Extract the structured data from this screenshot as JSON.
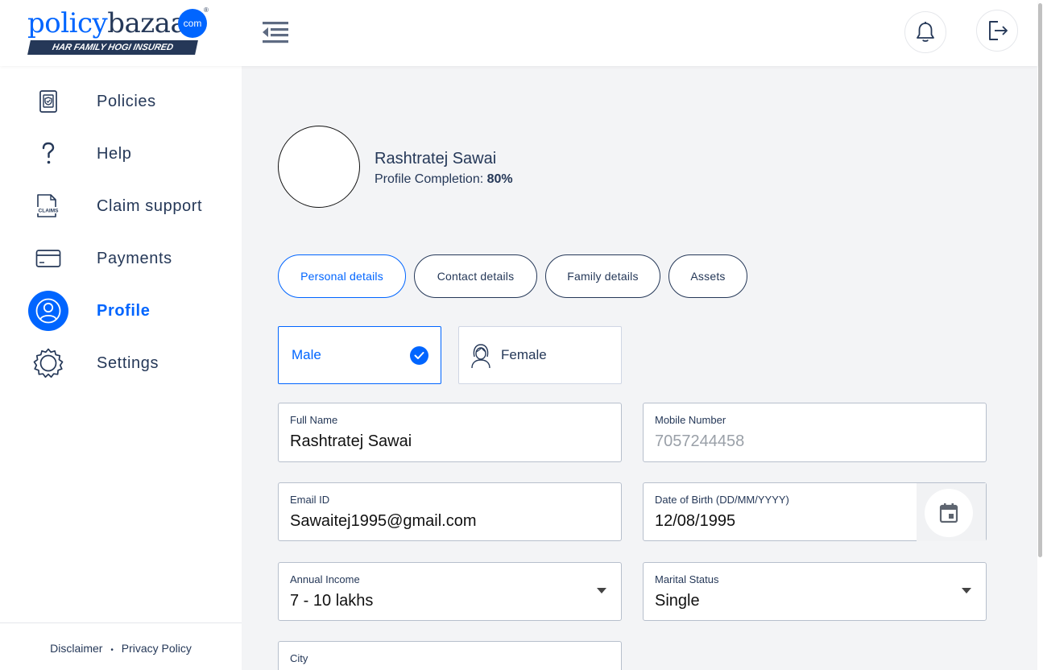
{
  "brand": {
    "logo_main": "policy",
    "logo_second": "bazaar",
    "logo_com": "com",
    "logo_reg": "®",
    "tagline": "HAR FAMILY HOGI INSURED",
    "accent": "#0065ff",
    "navy": "#253858"
  },
  "header": {
    "menu_icon": "collapse-menu-icon",
    "notification_icon": "bell-icon",
    "logout_icon": "logout-icon"
  },
  "sidebar": {
    "items": [
      {
        "label": "Policies",
        "icon": "policy-document-icon",
        "active": false
      },
      {
        "label": "Help",
        "icon": "question-icon",
        "active": false
      },
      {
        "label": "Claim support",
        "icon": "claims-document-icon",
        "active": false
      },
      {
        "label": "Payments",
        "icon": "credit-card-icon",
        "active": false
      },
      {
        "label": "Profile",
        "icon": "user-icon",
        "active": true
      },
      {
        "label": "Settings",
        "icon": "gear-icon",
        "active": false
      }
    ],
    "footer": {
      "disclaimer": "Disclaimer",
      "separator": "•",
      "privacy": "Privacy Policy"
    }
  },
  "profile": {
    "name": "Rashtratej Sawai",
    "completion_label": "Profile Completion:",
    "completion_value": "80%"
  },
  "tabs": [
    {
      "label": "Personal details",
      "active": true
    },
    {
      "label": "Contact details",
      "active": false
    },
    {
      "label": "Family details",
      "active": false
    },
    {
      "label": "Assets",
      "active": false
    }
  ],
  "gender": {
    "male": "Male",
    "female": "Female",
    "selected": "Male"
  },
  "form": {
    "full_name": {
      "label": "Full Name",
      "value": "Rashtratej Sawai"
    },
    "mobile": {
      "label": "Mobile Number",
      "value": "7057244458"
    },
    "email": {
      "label": "Email ID",
      "value": "Sawaitej1995@gmail.com"
    },
    "dob": {
      "label": "Date of Birth (DD/MM/YYYY)",
      "value": "12/08/1995"
    },
    "income": {
      "label": "Annual Income",
      "value": "7 - 10 lakhs"
    },
    "marital": {
      "label": "Marital Status",
      "value": "Single"
    },
    "city": {
      "label": "City",
      "value": ""
    }
  }
}
